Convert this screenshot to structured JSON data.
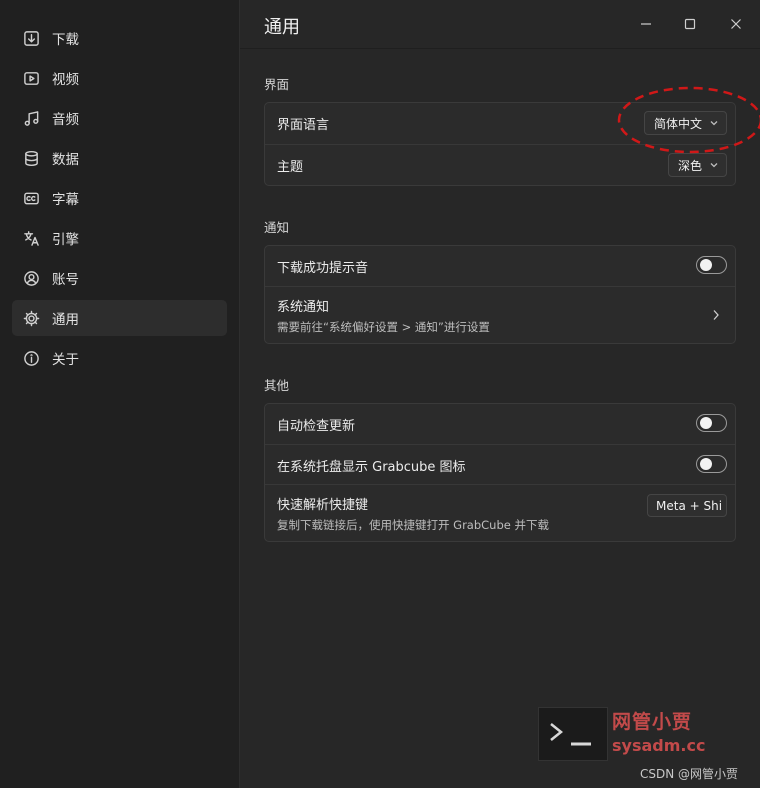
{
  "sidebar": {
    "items": [
      {
        "label": "下载",
        "icon": "download-icon"
      },
      {
        "label": "视频",
        "icon": "video-icon"
      },
      {
        "label": "音频",
        "icon": "audio-icon"
      },
      {
        "label": "数据",
        "icon": "database-icon"
      },
      {
        "label": "字幕",
        "icon": "subtitles-icon"
      },
      {
        "label": "引擎",
        "icon": "engine-icon"
      },
      {
        "label": "账号",
        "icon": "account-icon"
      },
      {
        "label": "通用",
        "icon": "gear-icon",
        "active": true
      },
      {
        "label": "关于",
        "icon": "info-icon"
      }
    ]
  },
  "header": {
    "title": "通用"
  },
  "sections": {
    "interface": {
      "title": "界面",
      "language": {
        "label": "界面语言",
        "value": "简体中文"
      },
      "theme": {
        "label": "主题",
        "value": "深色"
      }
    },
    "notify": {
      "title": "通知",
      "sound": {
        "label": "下载成功提示音",
        "enabled": false
      },
      "system": {
        "label": "系统通知",
        "desc": "需要前往“系统偏好设置 > 通知”进行设置"
      }
    },
    "other": {
      "title": "其他",
      "autoupdate": {
        "label": "自动检查更新",
        "enabled": false
      },
      "tray": {
        "label": "在系统托盘显示 Grabcube 图标",
        "enabled": false
      },
      "hotkey": {
        "label": "快速解析快捷键",
        "desc": "复制下载链接后，使用快捷键打开 GrabCube 并下载",
        "value": "Meta + Shi"
      }
    }
  },
  "watermark": {
    "brand": "网管小贾",
    "site": "sysadm.cc",
    "credit": "CSDN @网管小贾"
  },
  "colors": {
    "annotation": "#d01818",
    "watermark": "#c24a4a"
  }
}
